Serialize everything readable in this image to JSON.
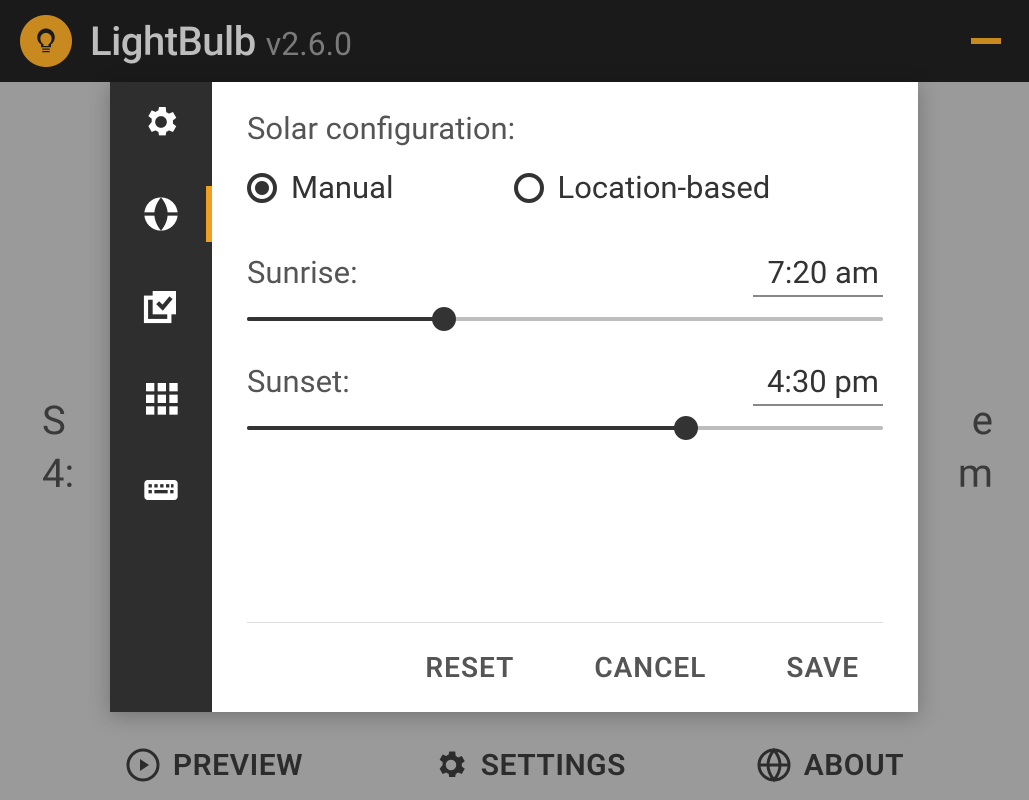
{
  "app": {
    "name": "LightBulb",
    "version": "v2.6.0"
  },
  "colors": {
    "accent": "#c88a1f",
    "sidebar_bg": "#2e2e2e",
    "highlight": "#f0a020"
  },
  "bg_window": {
    "line1_left": "S",
    "line2_left": "4:",
    "line1_right": "e",
    "line2_right": "m"
  },
  "sidebar": {
    "items": [
      {
        "name": "general",
        "icon": "gear-icon",
        "active": false
      },
      {
        "name": "location",
        "icon": "globe-icon",
        "active": true
      },
      {
        "name": "advanced",
        "icon": "checkbox-stack-icon",
        "active": false
      },
      {
        "name": "grid",
        "icon": "grid-icon",
        "active": false
      },
      {
        "name": "hotkeys",
        "icon": "keyboard-icon",
        "active": false
      }
    ]
  },
  "settings": {
    "section_title": "Solar configuration:",
    "options": [
      {
        "label": "Manual",
        "selected": true
      },
      {
        "label": "Location-based",
        "selected": false
      }
    ],
    "sliders": [
      {
        "label": "Sunrise:",
        "value": "7:20 am",
        "percent": 31
      },
      {
        "label": "Sunset:",
        "value": "4:30 pm",
        "percent": 69
      }
    ],
    "footer": {
      "reset": "RESET",
      "cancel": "CANCEL",
      "save": "SAVE"
    }
  },
  "bottombar": {
    "preview": "PREVIEW",
    "settings": "SETTINGS",
    "about": "ABOUT"
  }
}
